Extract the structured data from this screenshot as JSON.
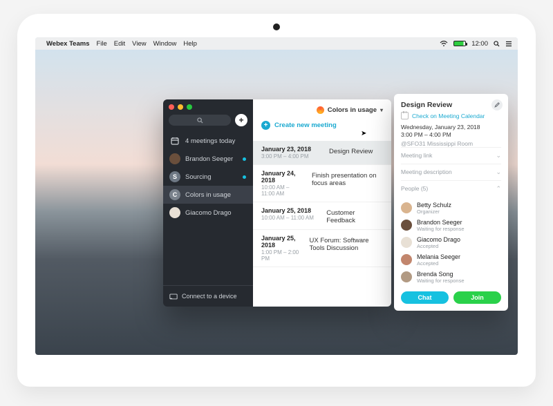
{
  "menubar": {
    "app": "Webex Teams",
    "items": [
      "File",
      "Edit",
      "View",
      "Window",
      "Help"
    ],
    "time": "12:00"
  },
  "sidebar": {
    "items": [
      {
        "label": "4 meetings today",
        "avatar_text": "",
        "avatar_type": "calendar",
        "unread": false
      },
      {
        "label": "Brandon Seeger",
        "avatar_text": "",
        "avatar_type": "photo",
        "avatar_color": "#6a4f3c",
        "unread": true
      },
      {
        "label": "Sourcing",
        "avatar_text": "S",
        "avatar_type": "letter",
        "avatar_color": "#6e7884",
        "unread": true
      },
      {
        "label": "Colors in usage",
        "avatar_text": "C",
        "avatar_type": "letter",
        "avatar_color": "#7a828c",
        "unread": false,
        "selected": true
      },
      {
        "label": "Giacomo Drago",
        "avatar_text": "",
        "avatar_type": "photo",
        "avatar_color": "#e8e0d5",
        "unread": false
      }
    ],
    "connect": "Connect to a device"
  },
  "main": {
    "create": "Create new meeting",
    "space_title": "Colors in usage",
    "meetings": [
      {
        "date": "January 23, 2018",
        "time": "3:00 PM – 4:00 PM",
        "title": "Design Review",
        "selected": true
      },
      {
        "date": "January 24, 2018",
        "time": "10:00 AM – 11:00 AM",
        "title": "Finish presentation on focus areas"
      },
      {
        "date": "January 25, 2018",
        "time": "10:00 AM – 11:00 AM",
        "title": "Customer Feedback"
      },
      {
        "date": "January 25, 2018",
        "time": "1:00 PM – 2:00 PM",
        "title": "UX Forum: Software Tools Discussion"
      }
    ]
  },
  "detail": {
    "title": "Design Review",
    "check_calendar": "Check on Meeting Calendar",
    "date_line": "Wednesday, January 23, 2018",
    "time_line": "3:00 PM – 4:00 PM",
    "location": "@SFO31 Mississippi Room",
    "acc_link": "Meeting link",
    "acc_desc": "Meeting description",
    "acc_people": "People (5)",
    "people": [
      {
        "name": "Betty Schulz",
        "status": "Organizer",
        "color": "#d9b48f"
      },
      {
        "name": "Brandon Seeger",
        "status": "Waiting for response",
        "color": "#6a4f3c"
      },
      {
        "name": "Giacomo Drago",
        "status": "Accepted",
        "color": "#e8e0d5"
      },
      {
        "name": "Melania Seeger",
        "status": "Accepted",
        "color": "#c2866d"
      },
      {
        "name": "Brenda Song",
        "status": "Waiting for response",
        "color": "#b29a83"
      }
    ],
    "chat": "Chat",
    "join": "Join"
  }
}
